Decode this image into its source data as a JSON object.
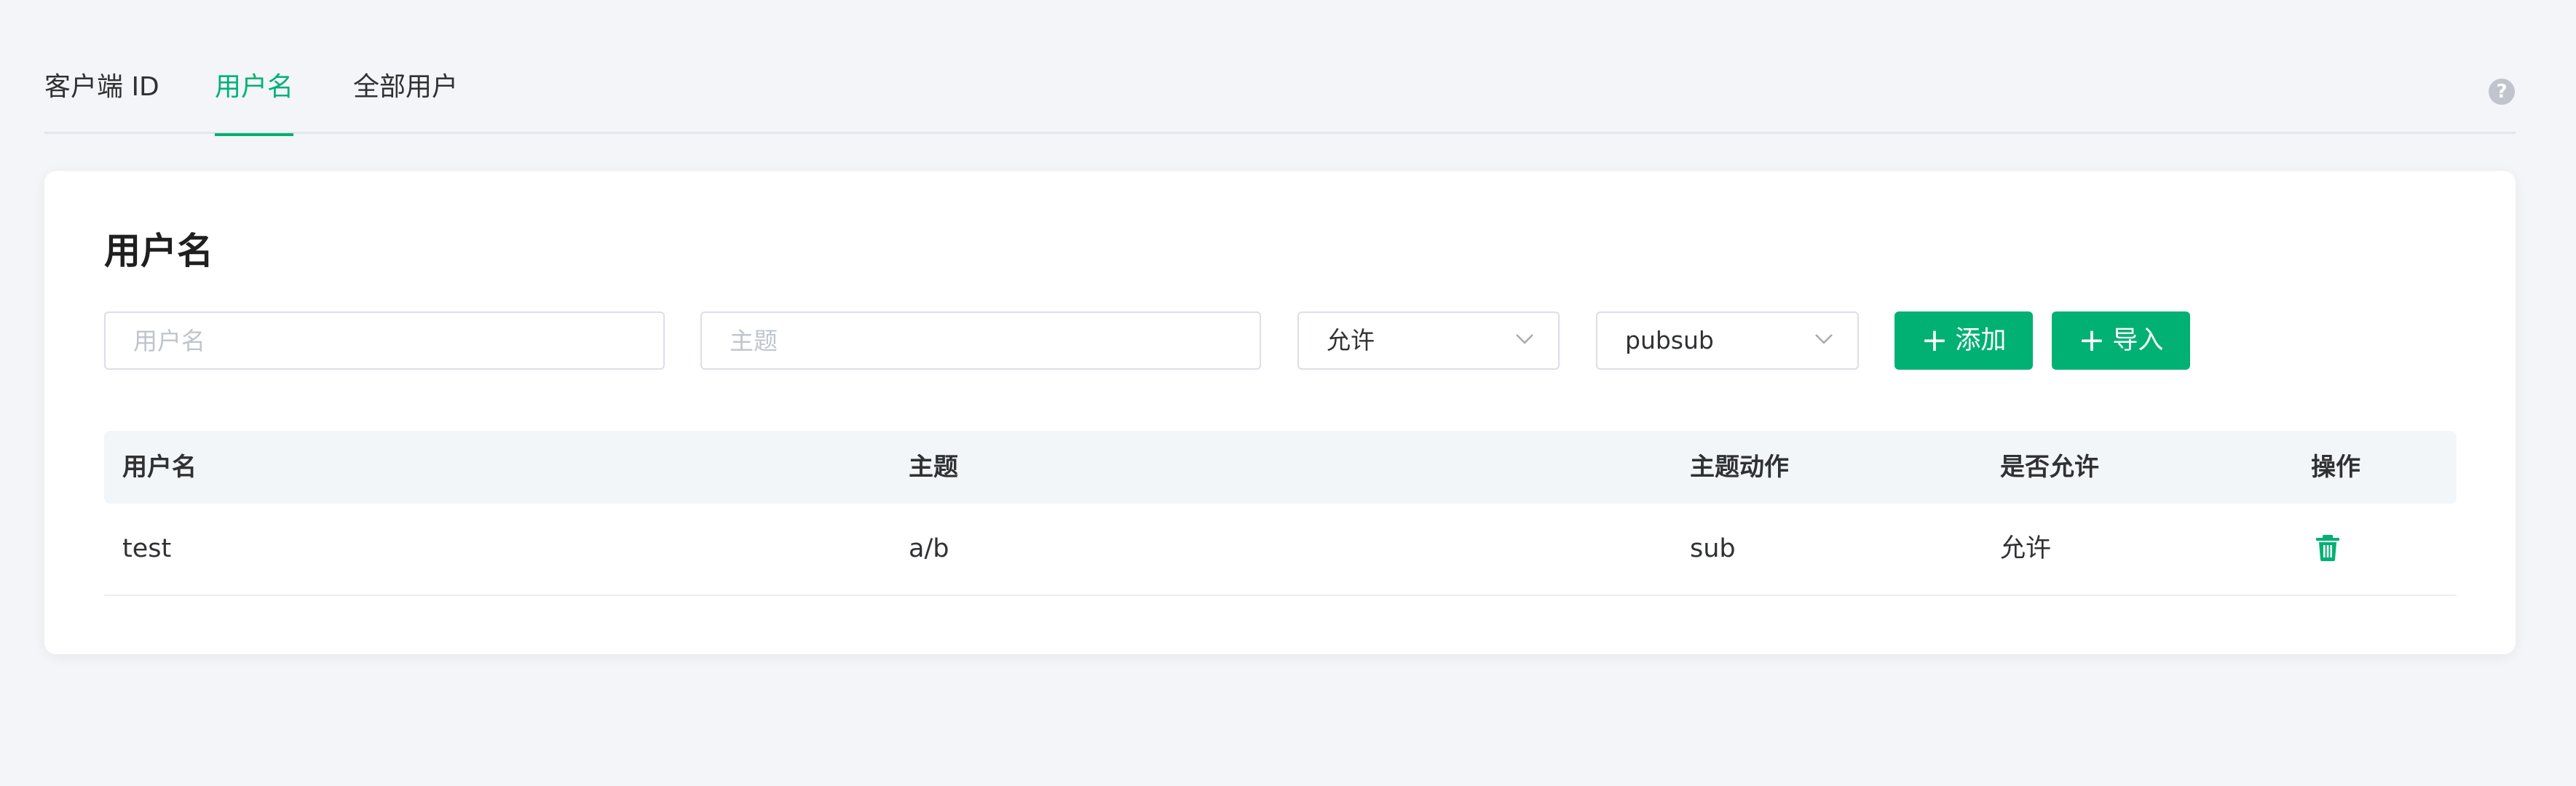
{
  "tabs": [
    {
      "label": "客户端 ID",
      "active": false
    },
    {
      "label": "用户名",
      "active": true
    },
    {
      "label": "全部用户",
      "active": false
    }
  ],
  "help_icon": "question-circle-icon",
  "card": {
    "title": "用户名"
  },
  "form": {
    "username_placeholder": "用户名",
    "topic_placeholder": "主题",
    "allow_select_value": "允许",
    "action_select_value": "pubsub",
    "add_button_label": "添加",
    "import_button_label": "导入"
  },
  "table": {
    "columns": [
      "用户名",
      "主题",
      "主题动作",
      "是否允许",
      "操作"
    ],
    "rows": [
      {
        "username": "test",
        "topic": "a/b",
        "action": "sub",
        "allow": "允许",
        "op_icon": "trash-icon"
      }
    ]
  },
  "colors": {
    "accent": "#00b173",
    "background": "#f3f5f8",
    "header_bg": "#f3f6f9"
  }
}
